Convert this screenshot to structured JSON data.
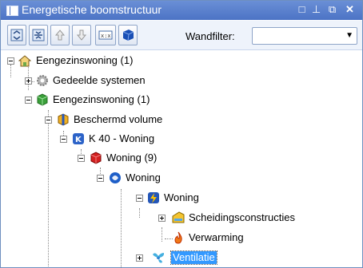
{
  "window": {
    "title": "Energetische boomstructuur"
  },
  "titlebar_buttons": [
    "□",
    "⊥",
    "⧉",
    "✕"
  ],
  "toolbar": {
    "buttons": [
      {
        "name": "expand-all-icon"
      },
      {
        "name": "collapse-all-icon"
      },
      {
        "name": "move-up-icon"
      },
      {
        "name": "move-down-icon"
      },
      {
        "name": "rename-icon"
      },
      {
        "name": "3d-view-icon"
      }
    ],
    "wall_filter_label": "Wandfilter:",
    "wall_filter_value": ""
  },
  "tree": {
    "items": [
      {
        "label": "Eengezinswoning (1)",
        "icon": "house-family-icon",
        "expander": "minus",
        "selected": false
      },
      {
        "label": "Gedeelde systemen",
        "icon": "gear-icon",
        "expander": "plus",
        "selected": false
      },
      {
        "label": "Eengezinswoning (1)",
        "icon": "green-cube-icon",
        "expander": "minus",
        "selected": false
      },
      {
        "label": "Beschermd volume",
        "icon": "yellow-box-icon",
        "expander": "minus",
        "selected": false
      },
      {
        "label": "K 40 - Woning",
        "icon": "blue-k-icon",
        "expander": "minus",
        "selected": false
      },
      {
        "label": "Woning (9)",
        "icon": "red-cube-icon",
        "expander": "minus",
        "selected": false
      },
      {
        "label": "Woning",
        "icon": "blue-swirl-icon",
        "expander": "minus",
        "selected": false
      },
      {
        "label": "Woning",
        "icon": "lightning-icon",
        "expander": "minus",
        "selected": false
      },
      {
        "label": "Scheidingsconstructies",
        "icon": "wall-icon",
        "expander": "plus",
        "selected": false
      },
      {
        "label": "Verwarming",
        "icon": "flame-icon",
        "expander": "none",
        "selected": false
      },
      {
        "label": "Ventilatie",
        "icon": "fan-icon",
        "expander": "plus",
        "selected": true
      }
    ]
  }
}
